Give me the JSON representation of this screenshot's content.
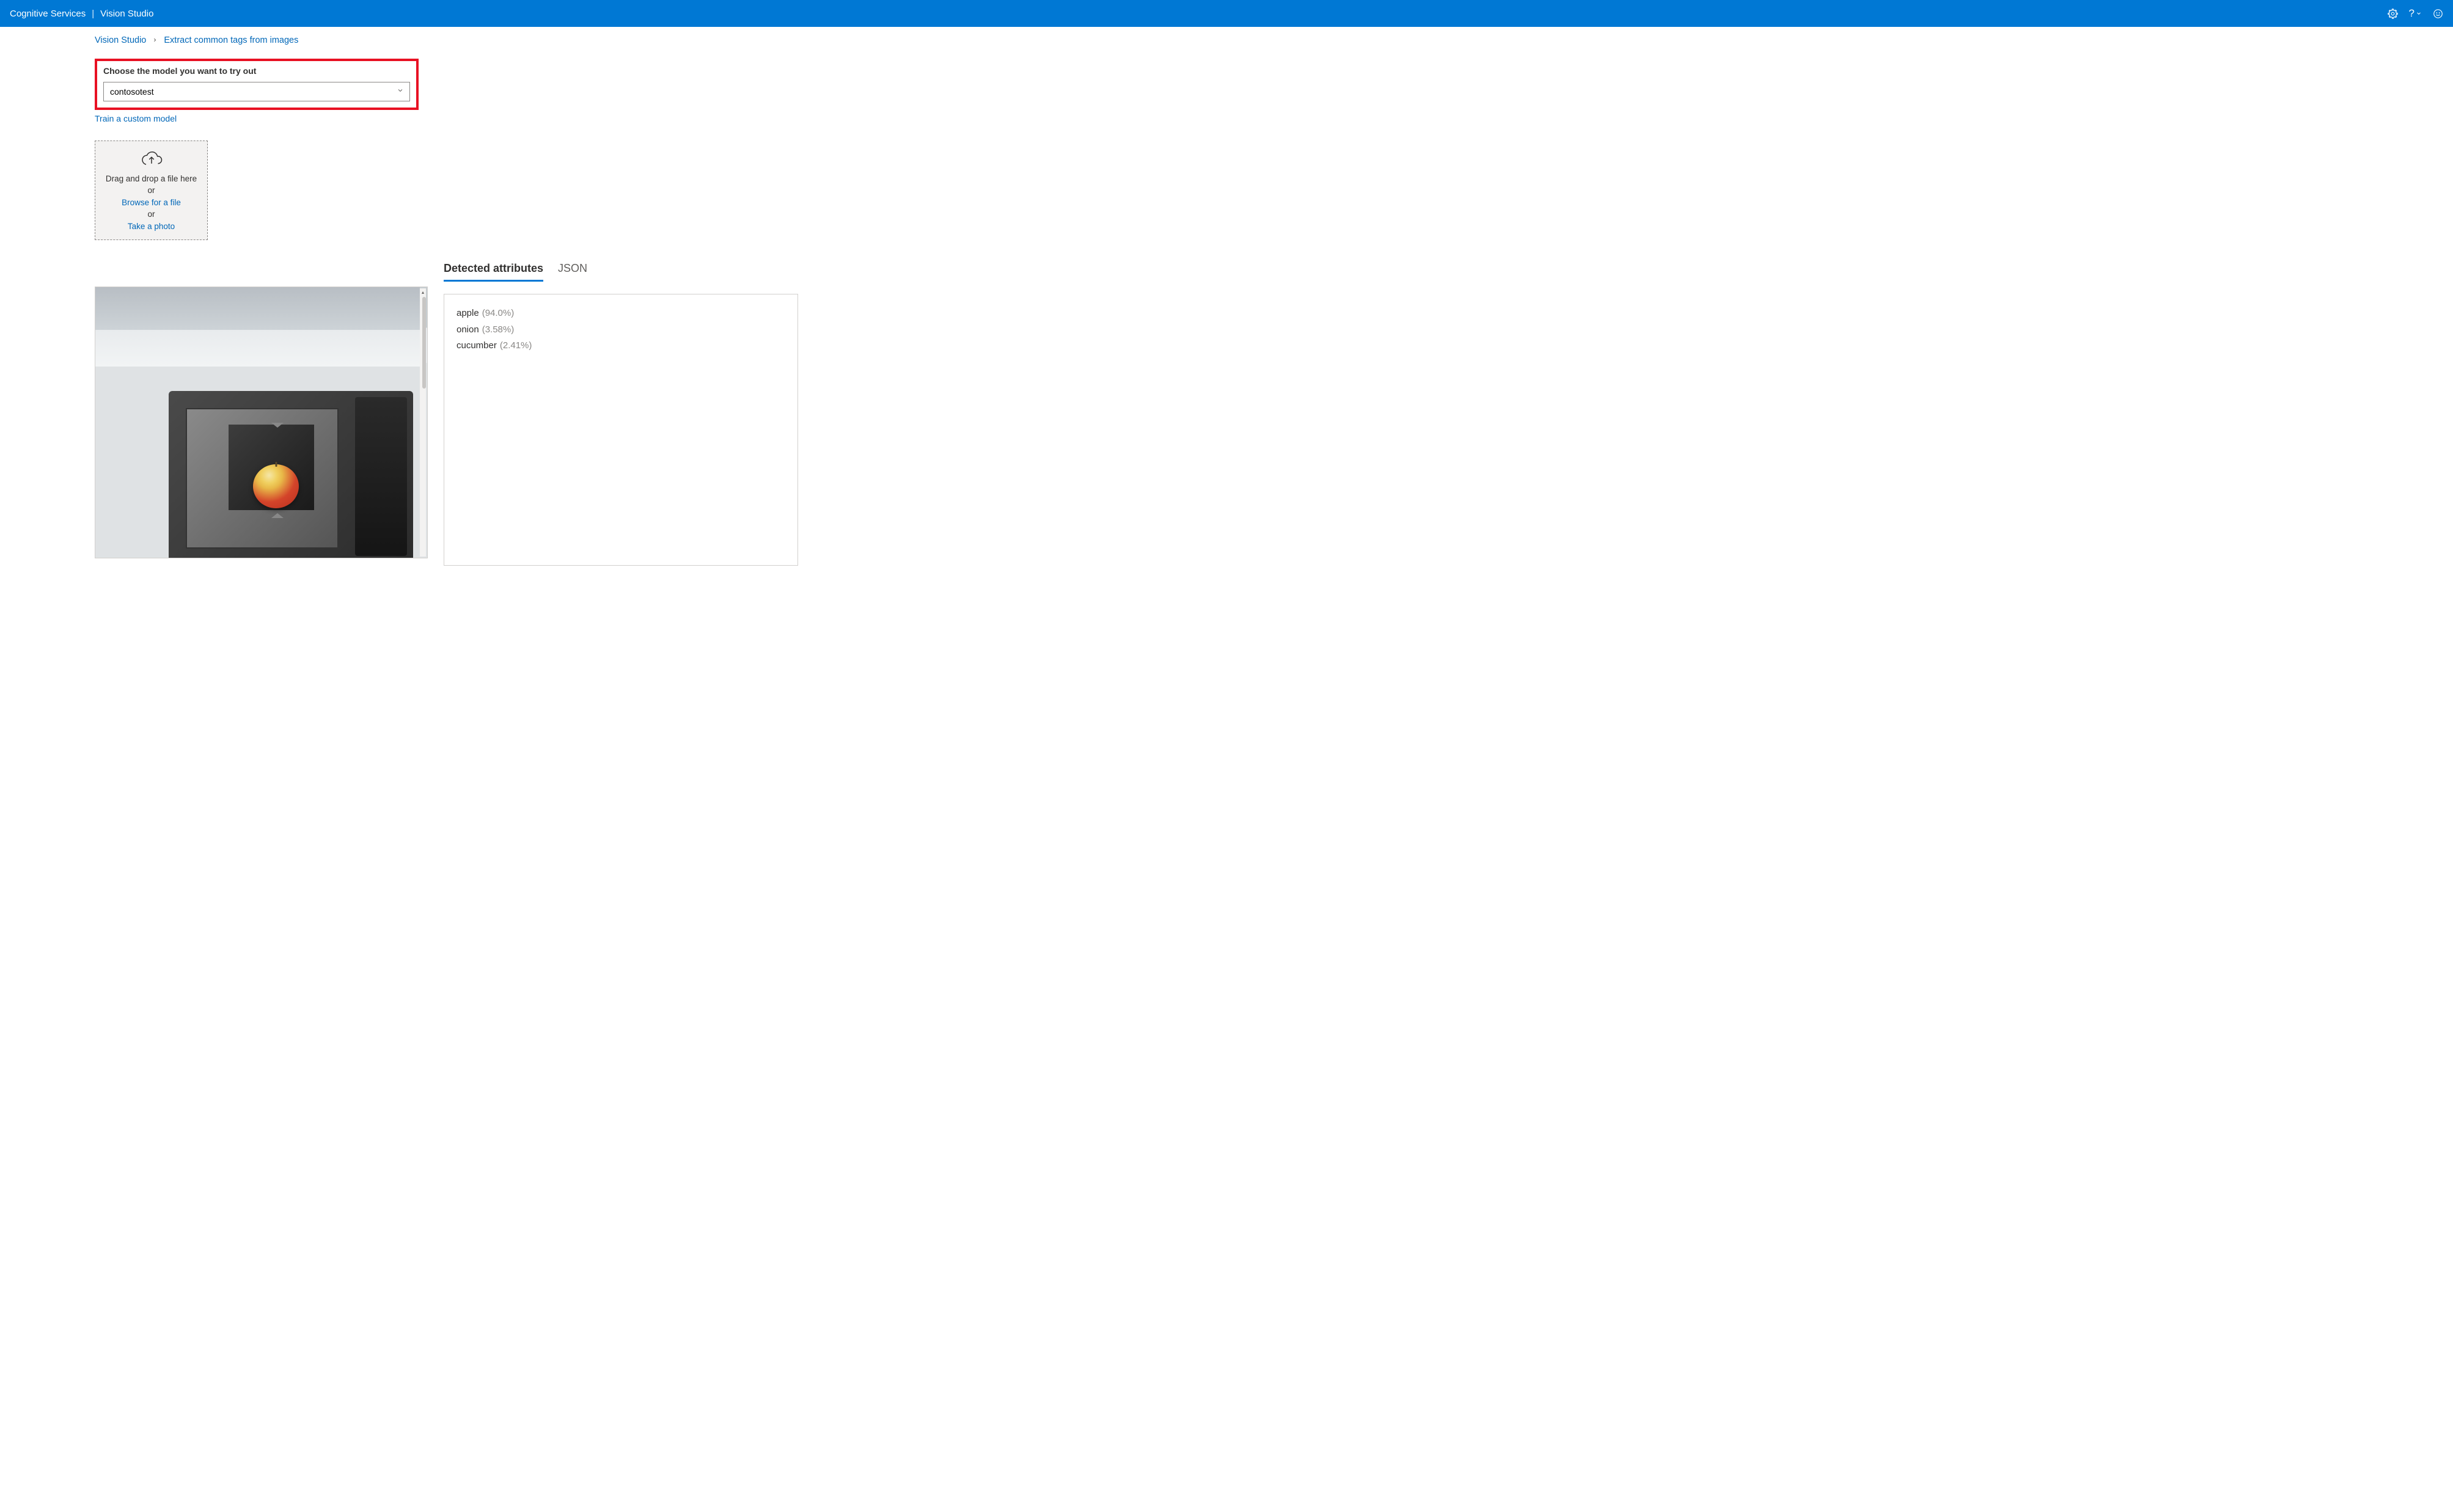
{
  "header": {
    "app_name": "Cognitive Services",
    "section": "Vision Studio"
  },
  "breadcrumb": {
    "root": "Vision Studio",
    "page": "Extract common tags from images"
  },
  "model_selector": {
    "label": "Choose the model you want to try out",
    "selected": "contosotest",
    "train_link": "Train a custom model"
  },
  "upload": {
    "drag_text": "Drag and drop a file here",
    "or1": "or",
    "browse": "Browse for a file",
    "or2": "or",
    "take_photo": "Take a photo"
  },
  "tabs": {
    "detected": "Detected attributes",
    "json": "JSON"
  },
  "results": [
    {
      "name": "apple",
      "confidence": "(94.0%)"
    },
    {
      "name": "onion",
      "confidence": "(3.58%)"
    },
    {
      "name": "cucumber",
      "confidence": "(2.41%)"
    }
  ]
}
